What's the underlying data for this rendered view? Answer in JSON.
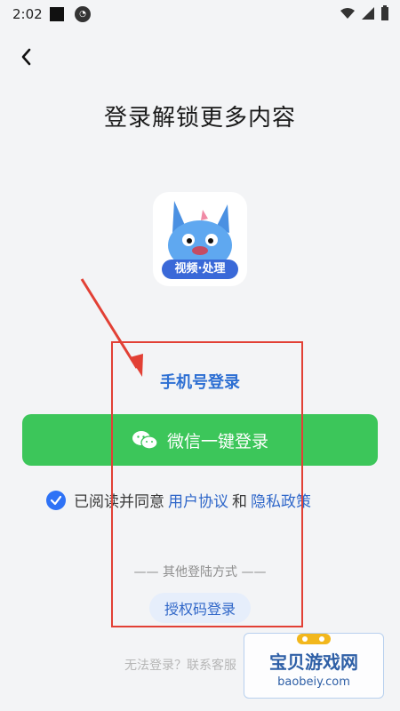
{
  "status_bar": {
    "time": "2:02"
  },
  "header": {
    "title": "登录解锁更多内容"
  },
  "app_icon": {
    "label": "视频·处理"
  },
  "phone_login_label": "手机号登录",
  "wechat_button_label": "微信一键登录",
  "agreement": {
    "prefix": "已阅读并同意",
    "user_agreement": "用户协议",
    "and": "和",
    "privacy_policy": "隐私政策"
  },
  "other_methods_label": "—— 其他登陆方式 ——",
  "auth_code_login_label": "授权码登录",
  "cannot_login_label": "无法登录？联系客服",
  "watermark": {
    "main": "宝贝游戏网",
    "sub": "baobeiy.com"
  },
  "colors": {
    "wechat_green": "#3cc65a",
    "link_blue": "#2e66c9",
    "annotation_red": "#e24035"
  }
}
